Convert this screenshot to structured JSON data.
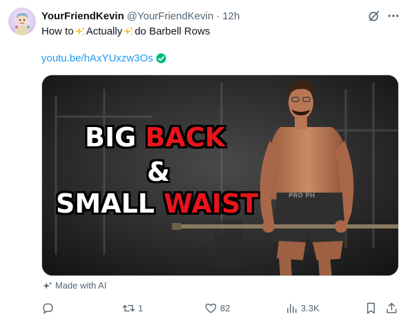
{
  "tweet": {
    "display_name": "YourFriendKevin",
    "handle": "@YourFriendKevin",
    "separator": "·",
    "time": "12h",
    "text_parts": [
      "How to",
      "Actually",
      "do Barbell Rows"
    ],
    "link_text": "youtu.be/hAxYUxzw3Os"
  },
  "thumbnail": {
    "line1_word1": "BIG",
    "line1_word2": "BACK",
    "line2": "&",
    "line3_word1": "SMALL",
    "line3_word2": "WAIST",
    "shorts_text": "PRO PH"
  },
  "ai_label": "Made with AI",
  "actions": {
    "reply_count": "",
    "retweet_count": "1",
    "like_count": "82",
    "views_count": "3.3K"
  },
  "colors": {
    "accent": "#1d9bf0",
    "text_secondary": "#536471",
    "thumb_red": "#e8151b",
    "verified_green": "#00ba7c"
  },
  "icons": [
    "avatar",
    "grok-icon",
    "more-icon",
    "sparkle-icon",
    "verified-icon",
    "ai-sparkle-icon",
    "reply-icon",
    "retweet-icon",
    "like-icon",
    "views-icon",
    "bookmark-icon",
    "share-icon"
  ]
}
